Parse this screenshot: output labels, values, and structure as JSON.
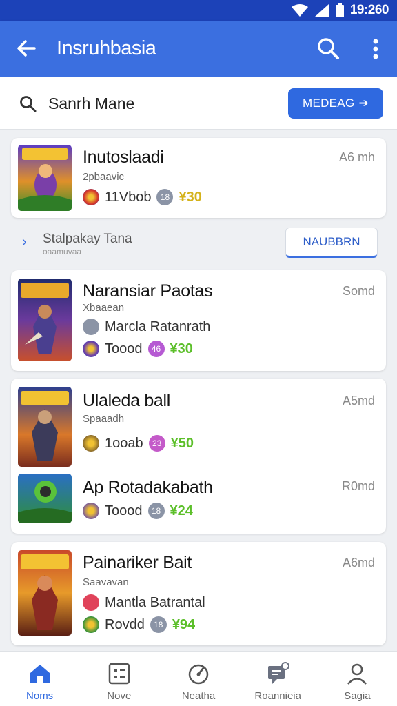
{
  "status_bar": {
    "time": "19:260"
  },
  "app_bar": {
    "title": "Insruhbasia"
  },
  "search": {
    "placeholder": "Sanrh Mane",
    "button_label": "MEDEAG"
  },
  "divider": {
    "label": "Stalpakay Tana",
    "sublabel": "oaamuvaa",
    "button_label": "NAUBBRN"
  },
  "cards": [
    {
      "entries": [
        {
          "title": "Inutoslaadi",
          "subtitle": "2pbaavic",
          "time": "A6 mh",
          "meta1_text": "11Vbob",
          "badge": "18",
          "price": "¥30"
        }
      ]
    },
    {
      "entries": [
        {
          "title": "Naransiar Paotas",
          "subtitle": "Xbaaean",
          "time": "Somd",
          "line1_text": "Marcla Ratanrath",
          "meta1_text": "Toood",
          "badge": "46",
          "price": "¥30"
        }
      ]
    },
    {
      "entries": [
        {
          "title": "Ulaleda ball",
          "subtitle": "Spaaadh",
          "time": "A5md",
          "meta1_text": "1ooab",
          "badge": "23",
          "price": "¥50"
        },
        {
          "title": "Ap Rotadakabath",
          "subtitle": "",
          "time": "R0md",
          "meta1_text": "Toood",
          "badge": "18",
          "price": "¥24"
        }
      ]
    },
    {
      "entries": [
        {
          "title": "Painariker Bait",
          "subtitle": "Saavavan",
          "time": "A6md",
          "line1_text": "Mantla Batrantal",
          "meta1_text": "Rovdd",
          "badge": "18",
          "price": "¥94"
        }
      ]
    }
  ],
  "bottom_nav": [
    {
      "label": "Noms",
      "icon": "home-icon",
      "active": true
    },
    {
      "label": "Nove",
      "icon": "grid-card-icon",
      "active": false
    },
    {
      "label": "Neatha",
      "icon": "compass-icon",
      "active": false
    },
    {
      "label": "Roannieia",
      "icon": "chat-icon",
      "active": false
    },
    {
      "label": "Sagia",
      "icon": "profile-icon",
      "active": false
    }
  ],
  "colors": {
    "status_bar": "#1c42b8",
    "app_bar": "#3b6fe0",
    "accent": "#2f69e0",
    "price_gold": "#d4b21a",
    "price_green": "#5cbf2a"
  }
}
